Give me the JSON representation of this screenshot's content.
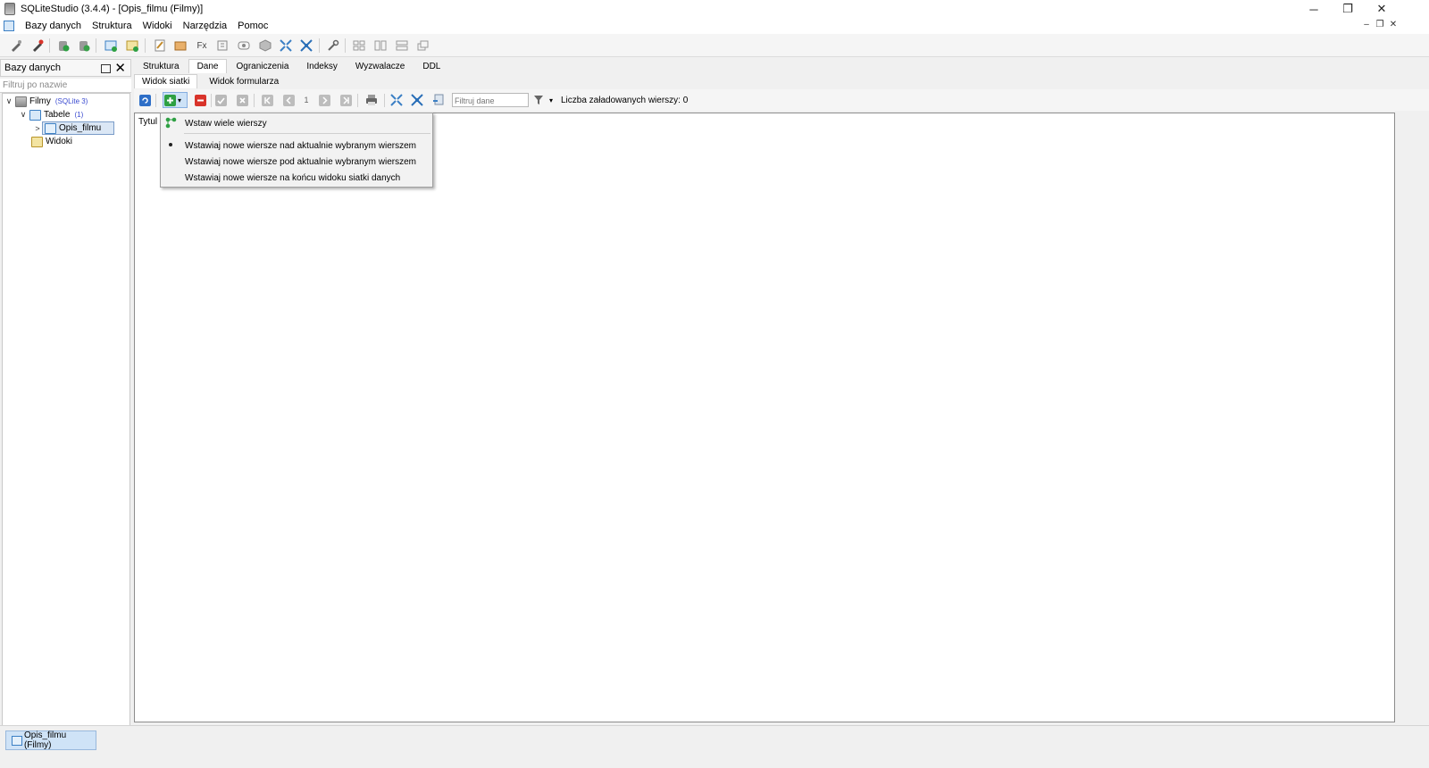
{
  "window": {
    "title": "SQLiteStudio (3.4.4) - [Opis_filmu (Filmy)]",
    "controls": {
      "minimize": "─",
      "restore": "❐",
      "close": "✕"
    },
    "mdi_controls": {
      "minimize": "–",
      "restore": "❐",
      "close": "✕"
    }
  },
  "menubar": {
    "items": [
      "Bazy danych",
      "Struktura",
      "Widoki",
      "Narzędzia",
      "Pomoc"
    ]
  },
  "toolbar": {
    "icons": [
      "connect-icon",
      "disconnect-icon",
      "add-database-icon",
      "remove-database-icon",
      "create-table-icon",
      "edit-table-icon",
      "sql-editor-icon",
      "ddl-history-icon",
      "functions-icon",
      "collations-icon",
      "extensions-icon",
      "snippets-icon",
      "expand-icon",
      "collapse-icon",
      "settings-icon",
      "tile-icon",
      "tile-vertical-icon",
      "tile-horizontal-icon",
      "cascade-icon"
    ],
    "functions_label": "Fx"
  },
  "dock": {
    "title": "Bazy danych",
    "close_glyph": "✕",
    "filter_placeholder": "Filtruj po nazwie",
    "tree": {
      "database": {
        "name": "Filmy",
        "type": "(SQLite 3)",
        "expander": "∨"
      },
      "tables": {
        "label": "Tabele",
        "count": "(1)",
        "expander": "∨"
      },
      "table": {
        "name": "Opis_filmu",
        "expander": ">"
      },
      "views": {
        "label": "Widoki"
      }
    }
  },
  "tabs": [
    "Struktura",
    "Dane",
    "Ograniczenia",
    "Indeksy",
    "Wyzwalacze",
    "DDL"
  ],
  "active_tab": "Dane",
  "subtabs": [
    "Widok siatki",
    "Widok formularza"
  ],
  "active_subtab": "Widok siatki",
  "data_toolbar": {
    "page_number": "1",
    "filter_placeholder": "Filtruj dane",
    "rows_loaded_label": "Liczba załadowanych wierszy: 0",
    "dropdown_arrow": "▾"
  },
  "grid": {
    "columns": [
      "Tytul"
    ]
  },
  "insert_menu": {
    "header_item": "Wstaw wiele wierszy",
    "options": [
      "Wstawiaj nowe wiersze nad aktualnie wybranym wierszem",
      "Wstawiaj nowe wiersze pod aktualnie wybranym wierszem",
      "Wstawiaj nowe wiersze na końcu widoku siatki danych"
    ],
    "selected_index": 0
  },
  "taskbar": {
    "window_button": "Opis_filmu (Filmy)"
  },
  "colors": {
    "accent": "#3b7fc4",
    "add_green": "#2ea043",
    "delete_red": "#d9342b",
    "selection_bg": "#dbe7f5"
  }
}
